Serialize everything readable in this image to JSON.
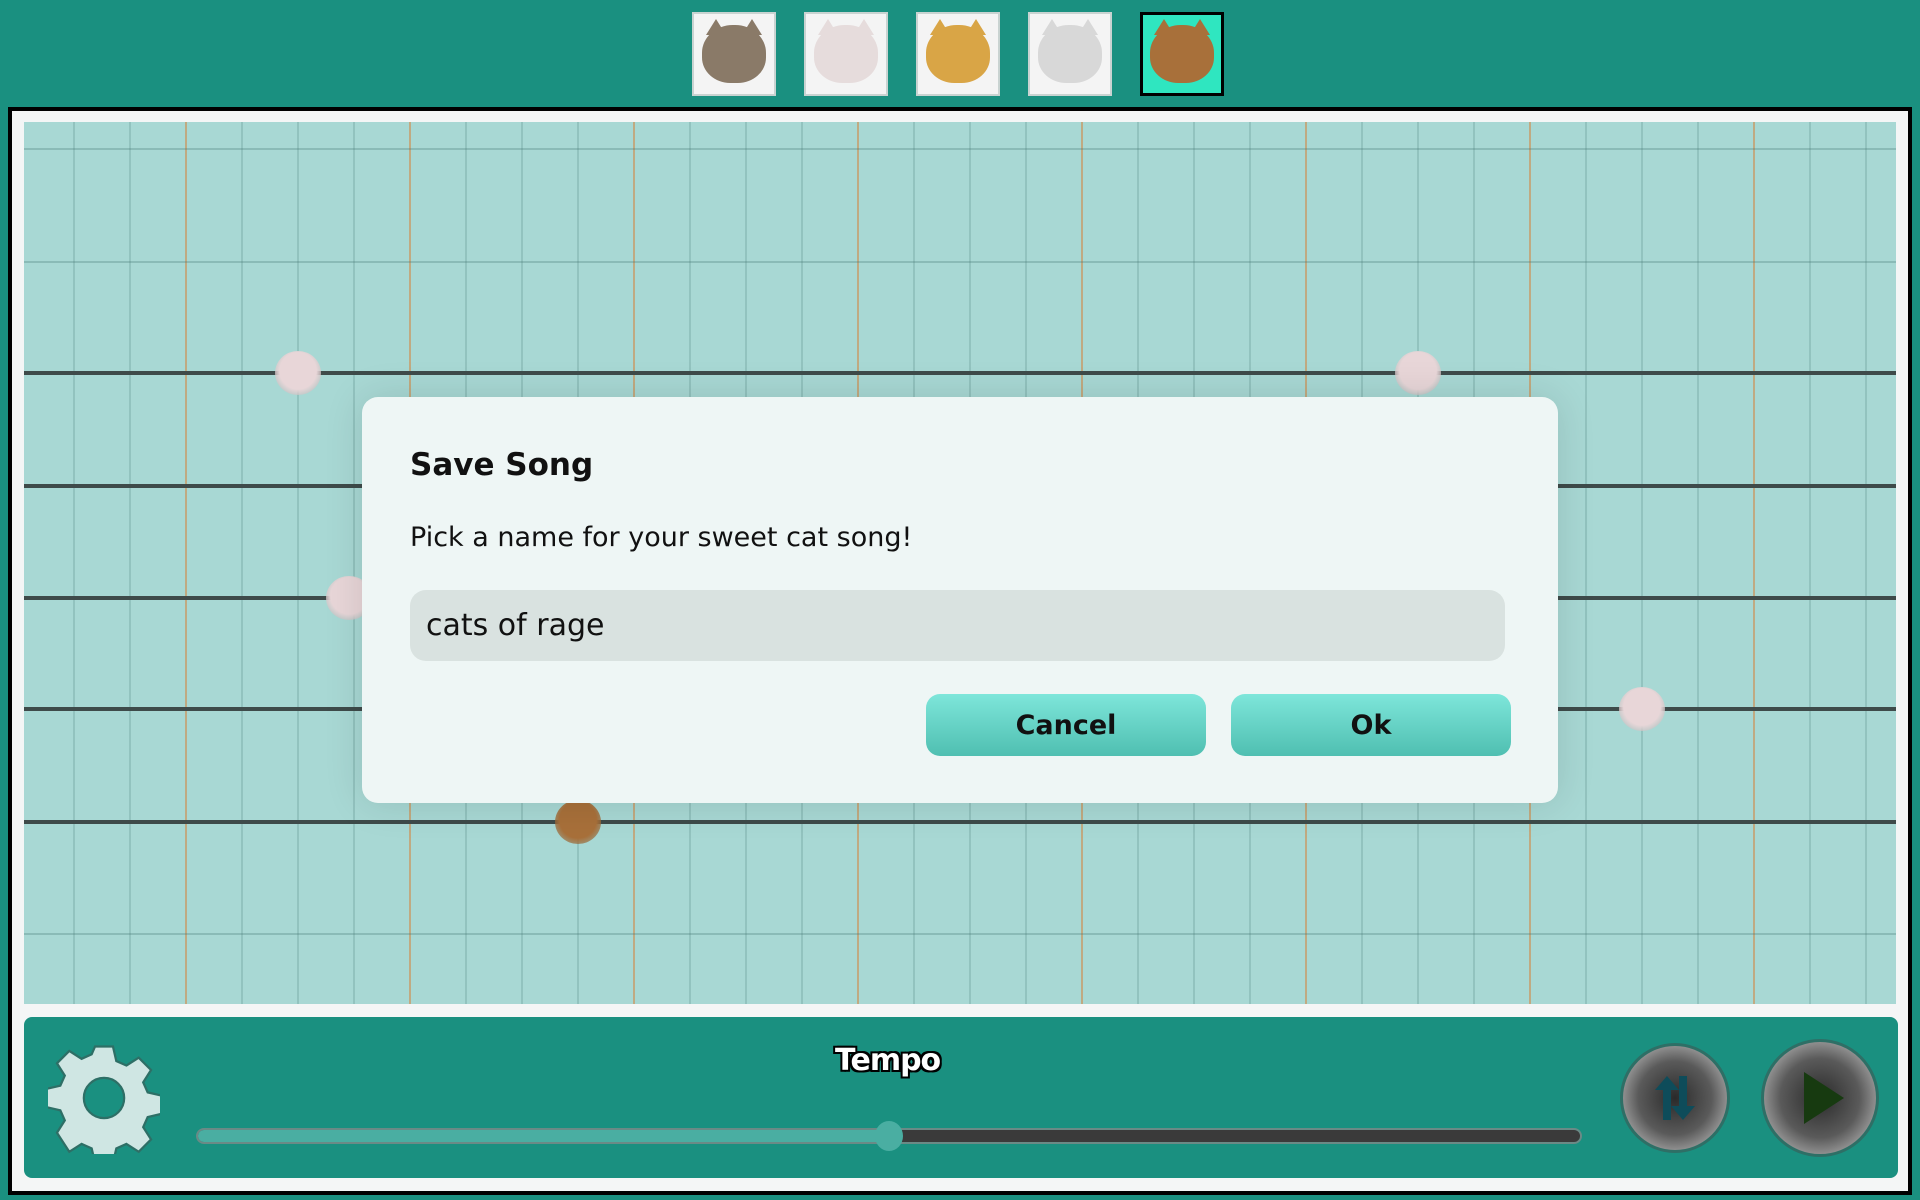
{
  "cat_selector": {
    "items": [
      {
        "name": "tabby-kitten",
        "icon": "tabby-kitten-icon",
        "color": "#8a7a68",
        "selected": false
      },
      {
        "name": "white-kitten",
        "icon": "white-kitten-icon",
        "color": "#e6dcdc",
        "selected": false
      },
      {
        "name": "orange-kitten",
        "icon": "orange-kitten-icon",
        "color": "#d9a546",
        "selected": false
      },
      {
        "name": "silver-kitten",
        "icon": "silver-kitten-icon",
        "color": "#d8d8d8",
        "selected": false
      },
      {
        "name": "lion",
        "icon": "lion-icon",
        "color": "#a8703a",
        "selected": true
      }
    ],
    "selected_bg": "#2fe6c0"
  },
  "notes": [
    {
      "cat": "white-kitten",
      "color": "#e8d6d8"
    },
    {
      "cat": "white-kitten",
      "color": "#e8d6d8"
    },
    {
      "cat": "white-kitten",
      "color": "#e8d6d8"
    },
    {
      "cat": "white-kitten",
      "color": "#e8d6d8"
    },
    {
      "cat": "lion",
      "color": "#a8703a"
    }
  ],
  "dialog": {
    "title": "Save Song",
    "message": "Pick a name for your sweet cat song!",
    "input_value": "cats of rage",
    "cancel_label": "Cancel",
    "ok_label": "Ok"
  },
  "controls": {
    "settings_icon": "gear-icon",
    "tempo_label": "Tempo",
    "tempo_fraction": 0.5,
    "loop_icon": "swap-arrows-icon",
    "play_icon": "play-icon"
  },
  "colors": {
    "accent": "#1a9080",
    "grid_bg": "#a8d8d4",
    "button": "#5fd1c4"
  }
}
